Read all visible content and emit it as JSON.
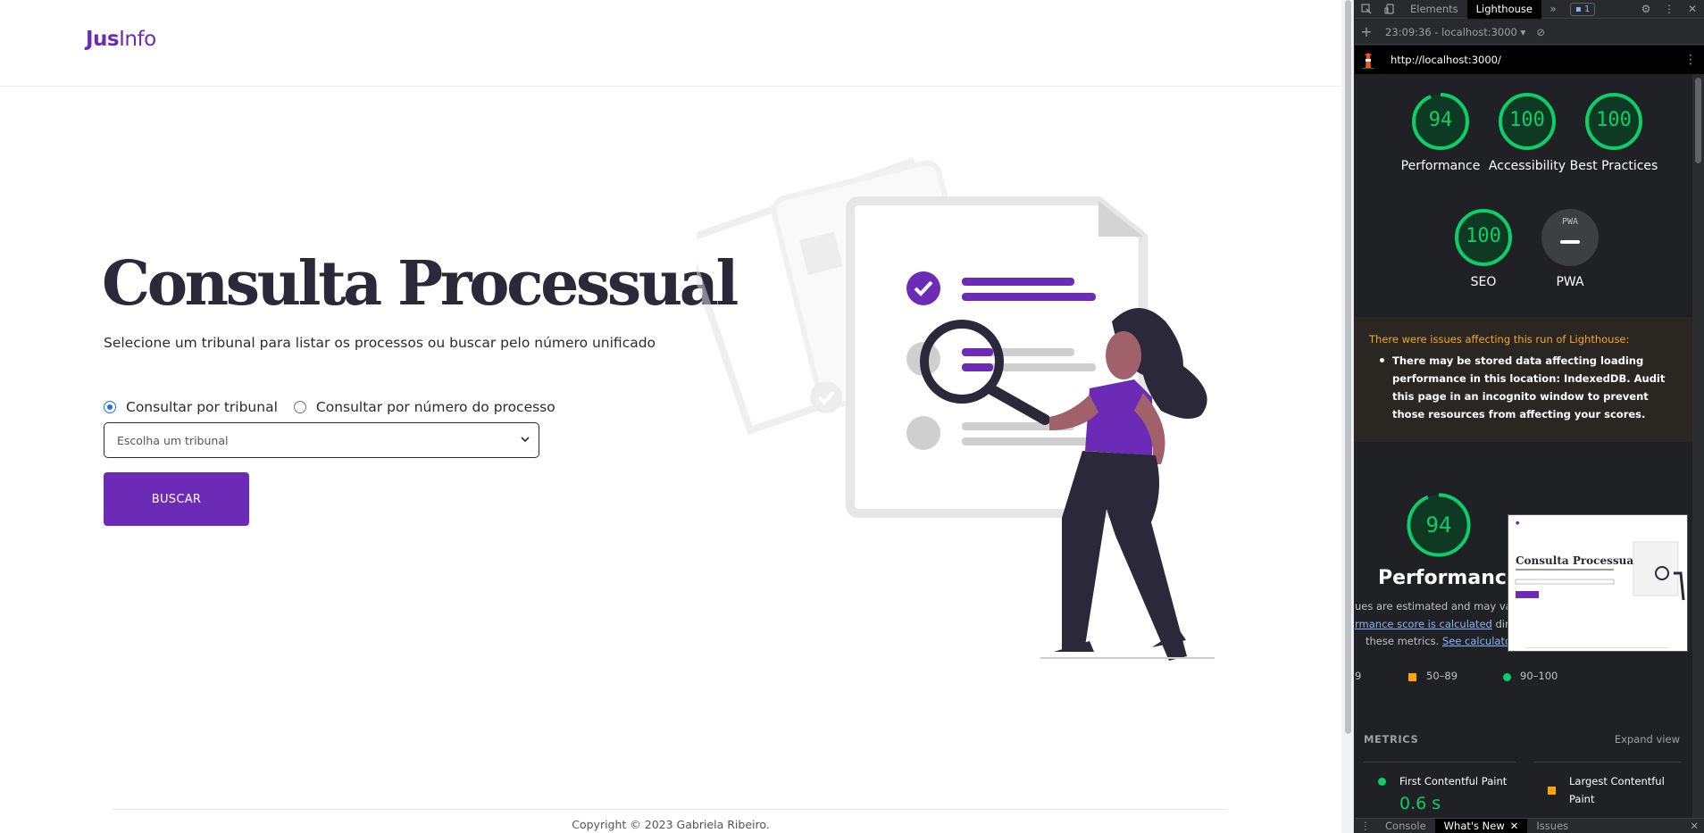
{
  "site": {
    "logo_bold": "Jus",
    "logo_rest": "Info",
    "title": "Consulta Processual",
    "subtitle": "Selecione um tribunal para listar os processos ou buscar pelo número unificado",
    "radio_options": [
      {
        "label": "Consultar por tribunal",
        "checked": true
      },
      {
        "label": "Consultar por número do processo",
        "checked": false
      }
    ],
    "select_placeholder": "Escolha um tribunal",
    "button_label": "BUSCAR",
    "footer": "Copyright © 2023 Gabriela Ribeiro.",
    "brand_color": "#6c2bb7"
  },
  "devtools": {
    "tabs": [
      "Elements",
      "Lighthouse"
    ],
    "active_tab": "Lighthouse",
    "more_tabs_icon": "»",
    "issues_badge": "1",
    "session": "23:09:36 - localhost:3000",
    "url": "http://localhost:3000/",
    "scores": [
      {
        "label": "Performance",
        "value": 94
      },
      {
        "label": "Accessibility",
        "value": 100
      },
      {
        "label": "Best Practices",
        "value": 100
      },
      {
        "label": "SEO",
        "value": 100
      },
      {
        "label": "PWA",
        "value": "PWA"
      }
    ],
    "warning": {
      "title": "There were issues affecting this run of Lighthouse:",
      "item": "There may be stored data affecting loading performance in this location: IndexedDB. Audit this page in an incognito window to prevent those resources from affecting your scores."
    },
    "performance": {
      "score": 94,
      "label": "Performance",
      "note_1": "ues are estimated and may vary.",
      "note_2_link": "rmance score is calculated",
      "note_2_rest": "direc",
      "note_3_pre": "these metrics.",
      "note_3_link": "See calculato"
    },
    "legend": [
      "9",
      "50–89",
      "90–100"
    ],
    "metrics": {
      "heading": "METRICS",
      "expand": "Expand view",
      "items": [
        {
          "name": "First Contentful Paint",
          "value": "0.6 s",
          "status": "good"
        },
        {
          "name": "Largest Contentful Paint",
          "value": "",
          "status": "average"
        }
      ]
    },
    "drawer": {
      "tabs": [
        "Console",
        "What's New",
        "Issues"
      ],
      "active": "What's New"
    },
    "colors": {
      "good": "#0cce6b",
      "average": "#ffa400",
      "warn": "#f6a52d"
    }
  }
}
